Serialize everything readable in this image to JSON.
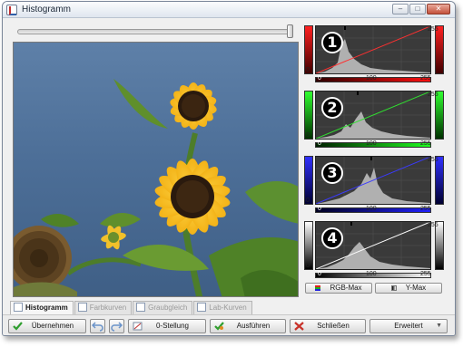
{
  "window": {
    "title": "Histogramm",
    "minimize_glyph": "–",
    "maximize_glyph": "□",
    "close_glyph": "✕"
  },
  "histograms": [
    {
      "badge": "1",
      "channel": "red",
      "label_top": "255",
      "label_left": "0",
      "label_min": "0",
      "label_mid": "100",
      "label_max": "255",
      "accent": "#e02020"
    },
    {
      "badge": "2",
      "channel": "green",
      "label_top": "255",
      "label_left": "0",
      "label_min": "0",
      "label_mid": "100",
      "label_max": "255",
      "accent": "#20c020"
    },
    {
      "badge": "3",
      "channel": "blue",
      "label_top": "255",
      "label_left": "0",
      "label_min": "0",
      "label_mid": "100",
      "label_max": "255",
      "accent": "#3030e0"
    },
    {
      "badge": "4",
      "channel": "luminance",
      "label_top": "255",
      "label_left": "0",
      "label_min": "0",
      "label_mid": "100",
      "label_max": "255",
      "accent": "#ffffff"
    }
  ],
  "panel_buttons": {
    "rgb_max": "RGB-Max",
    "y_max": "Y-Max"
  },
  "tabs": [
    {
      "label": "Histogramm",
      "active": true
    },
    {
      "label": "Farbkurven",
      "active": false
    },
    {
      "label": "Graubgleich",
      "active": false
    },
    {
      "label": "Lab-Kurven",
      "active": false
    }
  ],
  "bottom": {
    "apply": "Übernehmen",
    "reset": "0-Stellung",
    "execute": "Ausführen",
    "close": "Schließen",
    "advanced": "Erweitert"
  },
  "colors": {
    "check_green": "#2f9e2f",
    "close_red": "#c8322a"
  }
}
